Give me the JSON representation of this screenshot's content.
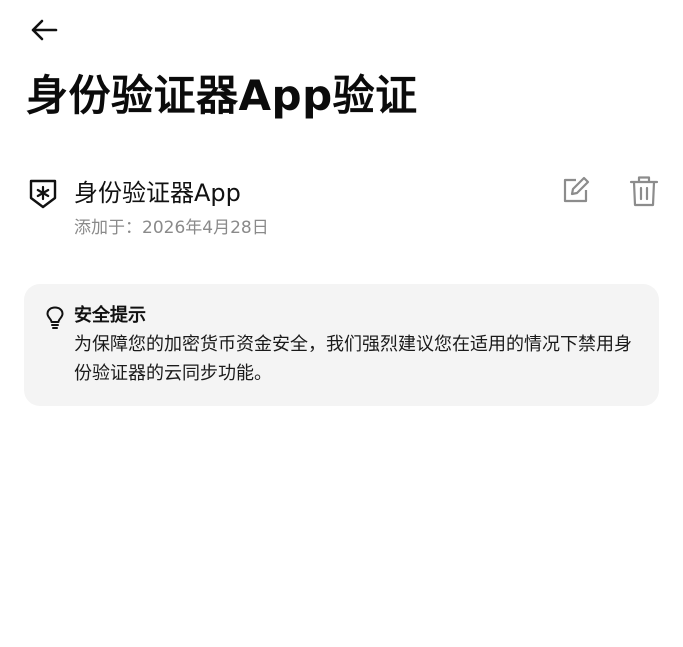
{
  "header": {
    "back_icon": "arrow-left-icon",
    "title": "身份验证器App验证"
  },
  "method": {
    "icon": "shield-asterisk-icon",
    "name": "身份验证器App",
    "date_label": "添加于：",
    "date_value": "2026年4月28日",
    "edit_icon": "edit-icon",
    "delete_icon": "trash-icon"
  },
  "notice": {
    "icon": "lightbulb-icon",
    "title": "安全提示",
    "body": "为保障您的加密货币资金安全，我们强烈建议您在适用的情况下禁用身份验证器的云同步功能。"
  },
  "colors": {
    "text_primary": "#111111",
    "text_secondary": "#8a8a8a",
    "card_background": "#f4f4f4",
    "icon_muted": "#8c8c8c"
  }
}
